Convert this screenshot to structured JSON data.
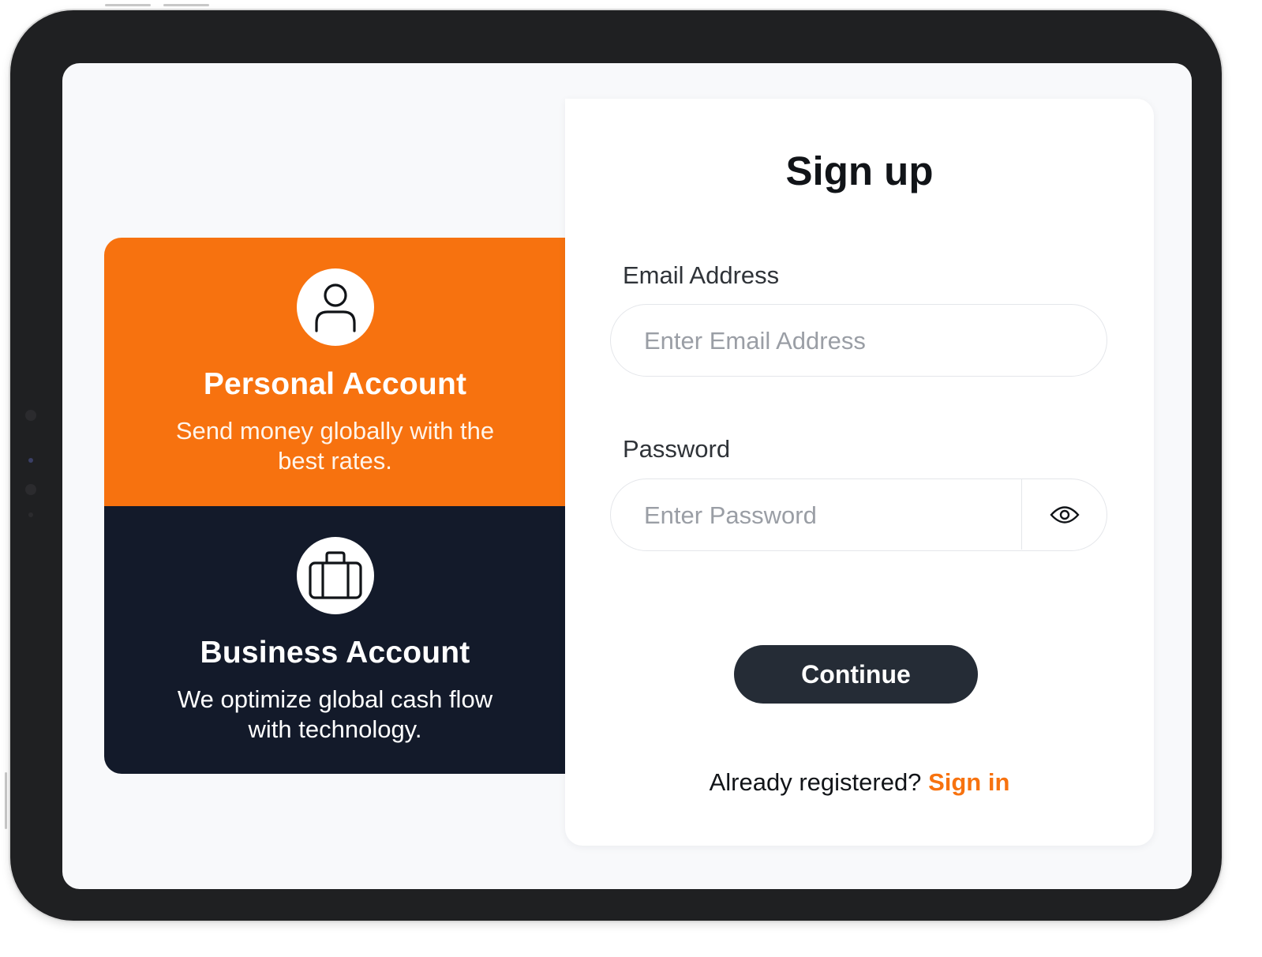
{
  "accounts": {
    "personal": {
      "icon": "user-icon",
      "title": "Personal Account",
      "description": "Send money globally with the best rates.",
      "color": "#f7720f"
    },
    "business": {
      "icon": "briefcase-icon",
      "title": "Business Account",
      "description": "We optimize global cash flow with technology.",
      "color": "#131a2a"
    }
  },
  "signup": {
    "title": "Sign up",
    "email": {
      "label": "Email Address",
      "placeholder": "Enter Email Address",
      "value": ""
    },
    "password": {
      "label": "Password",
      "placeholder": "Enter Password",
      "value": "",
      "toggle_icon": "eye-icon"
    },
    "continue_label": "Continue",
    "already_text": "Already registered?",
    "signin_label": "Sign in",
    "accent_color": "#f7720f",
    "button_color": "#252c36"
  }
}
